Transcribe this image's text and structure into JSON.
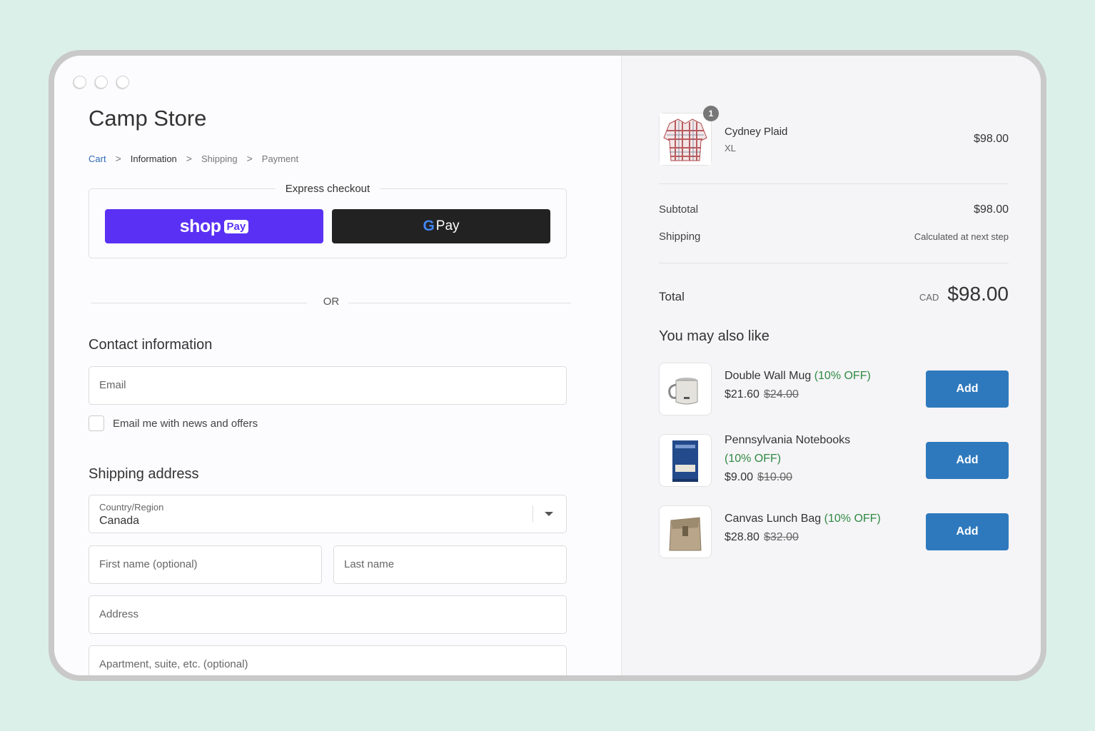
{
  "window": {
    "traffic_lights": 3
  },
  "store": {
    "title": "Camp Store"
  },
  "breadcrumb": {
    "items": [
      "Cart",
      "Information",
      "Shipping",
      "Payment"
    ]
  },
  "express": {
    "title": "Express checkout",
    "shop_pay": {
      "word": "shop",
      "badge": "Pay"
    },
    "gpay": {
      "g": "G",
      "word": "Pay"
    }
  },
  "divider": {
    "or": "OR"
  },
  "contact": {
    "title": "Contact information",
    "email_placeholder": "Email",
    "newsletter_label": "Email me with news and offers"
  },
  "shipping": {
    "title": "Shipping address",
    "country_label": "Country/Region",
    "country_value": "Canada",
    "first_name_placeholder": "First name (optional)",
    "last_name_placeholder": "Last name",
    "address_placeholder": "Address",
    "apartment_placeholder": "Apartment, suite, etc. (optional)"
  },
  "cart": {
    "item": {
      "name": "Cydney Plaid",
      "variant": "XL",
      "price": "$98.00",
      "quantity": "1"
    },
    "subtotal_label": "Subtotal",
    "subtotal_value": "$98.00",
    "shipping_label": "Shipping",
    "shipping_value": "Calculated at next step",
    "total_label": "Total",
    "total_currency": "CAD",
    "total_value": "$98.00"
  },
  "recommendations": {
    "title": "You may also like",
    "items": [
      {
        "name": "Double Wall Mug",
        "discount": "(10% OFF)",
        "price": "$21.60",
        "old_price": "$24.00",
        "button": "Add"
      },
      {
        "name": "Pennsylvania Notebooks",
        "discount": "(10% OFF)",
        "price": "$9.00",
        "old_price": "$10.00",
        "button": "Add"
      },
      {
        "name": "Canvas Lunch Bag",
        "discount": "(10% OFF)",
        "price": "$28.80",
        "old_price": "$32.00",
        "button": "Add"
      }
    ]
  },
  "colors": {
    "shop_pay": "#5a31f4",
    "gpay": "#222222",
    "add_button": "#2e79bd",
    "discount": "#2f8a45",
    "link": "#2e6bb8"
  }
}
